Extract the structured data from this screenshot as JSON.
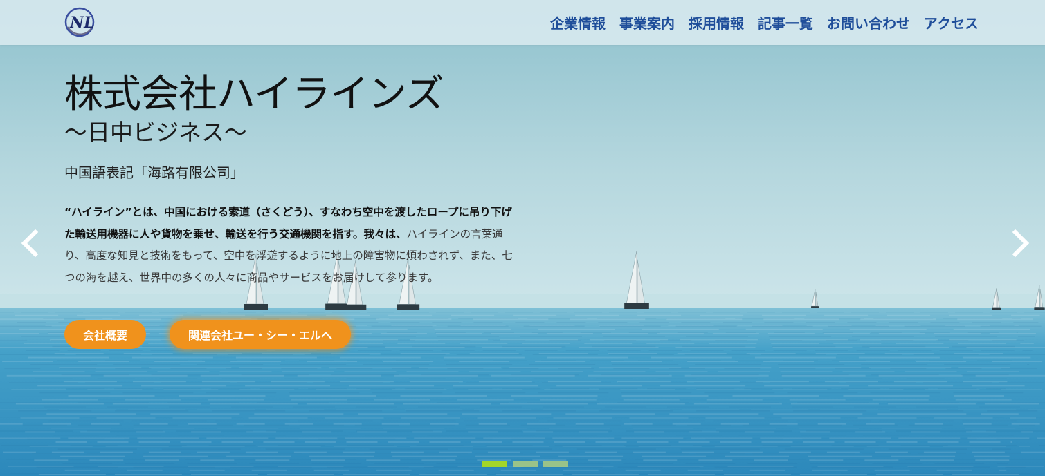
{
  "header": {
    "nav": [
      {
        "label": "企業情報"
      },
      {
        "label": "事業案内"
      },
      {
        "label": "採用情報"
      },
      {
        "label": "記事一覧"
      },
      {
        "label": "お問い合わせ"
      },
      {
        "label": "アクセス"
      }
    ],
    "logo_text": "NL"
  },
  "hero": {
    "title": "株式会社ハイラインズ",
    "subtitle": "～日中ビジネス～",
    "chinese_name": "中国語表記「海路有限公司」",
    "description_strong": "“ハイライン”とは、中国における索道（さくどう）、すなわち空中を渡したロープに吊り下げた輸送用機器に人や貨物を乗せ、輸送を行う交通機関を指す。我々は、",
    "description_light": "ハイラインの言葉通り、高度な知見と技術をもって、空中を浮遊するように地上の障害物に煩わされず、また、七つの海を越え、世界中の多くの人々に商品やサービスをお届けして参ります。",
    "buttons": [
      {
        "label": "会社概要"
      },
      {
        "label": "関連会社ユー・シー・エルへ"
      }
    ]
  },
  "carousel": {
    "slide_count": 3,
    "active_index": 0,
    "prev_icon": "chevron-left-icon",
    "next_icon": "chevron-right-icon"
  },
  "colors": {
    "nav_text": "#1f4e9a",
    "button_bg": "#f0921c",
    "dot_active": "#a3d62a",
    "sky_top": "#cfe6ec",
    "sea": "#2f8fc0"
  }
}
